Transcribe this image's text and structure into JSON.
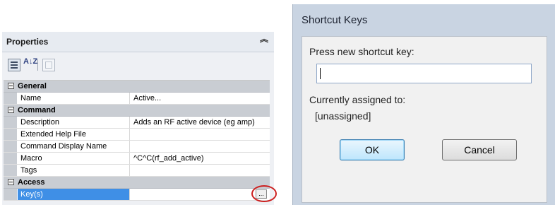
{
  "properties_panel": {
    "title": "Properties",
    "collapse_icon": "double-chevron-up-icon",
    "toolbar": {
      "categorized_icon": "categorized-view-icon",
      "alphabetical_icon": "sort-az-icon",
      "az_glyph": "A↓Z",
      "property_pages_icon": "property-pages-icon"
    },
    "categories": [
      {
        "label": "General",
        "rows": [
          {
            "name": "Name",
            "value": "Active..."
          }
        ]
      },
      {
        "label": "Command",
        "rows": [
          {
            "name": "Description",
            "value": "Adds an RF active device (eg amp)"
          },
          {
            "name": "Extended Help File",
            "value": ""
          },
          {
            "name": "Command Display Name",
            "value": ""
          },
          {
            "name": "Macro",
            "value": "^C^C(rf_add_active)"
          },
          {
            "name": "Tags",
            "value": ""
          }
        ]
      },
      {
        "label": "Access",
        "rows": [
          {
            "name": "Key(s)",
            "value": "",
            "selected": true,
            "button_label": "..."
          }
        ]
      }
    ],
    "selection_color": "#3f8fe6",
    "highlight_color": "#cc1f1f"
  },
  "shortcut_dialog": {
    "title": "Shortcut Keys",
    "prompt": "Press new shortcut key:",
    "input_value": "",
    "assigned_label": "Currently assigned to:",
    "assigned_value": "[unassigned]",
    "ok_label": "OK",
    "cancel_label": "Cancel"
  }
}
